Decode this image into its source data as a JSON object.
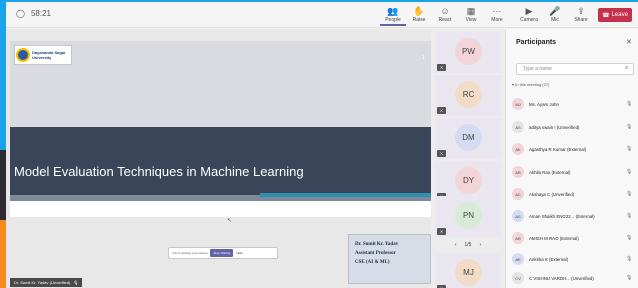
{
  "top_bar": {
    "timer": "58:21",
    "buttons": [
      {
        "label": "People",
        "icon": "people-icon"
      },
      {
        "label": "Raise",
        "icon": "raise-hand-icon"
      },
      {
        "label": "React",
        "icon": "react-icon"
      },
      {
        "label": "View",
        "icon": "view-icon"
      },
      {
        "label": "More",
        "icon": "more-icon"
      },
      {
        "label": "Camera",
        "icon": "camera-icon"
      },
      {
        "label": "Mic",
        "icon": "mic-icon"
      },
      {
        "label": "Share",
        "icon": "share-icon"
      }
    ],
    "leave_label": "Leave"
  },
  "slide": {
    "logo_text_line1": "Dayananda Sagar",
    "logo_text_line2": "University",
    "title": "Model Evaluation Techniques in Machine Learning",
    "page_number": "1"
  },
  "share_notice": {
    "text": "You're sharing your screen",
    "stop_label": "Stop sharing",
    "hide_label": "Hide"
  },
  "presenter_card": {
    "name": "Dr. Sumit Kr. Yadav",
    "role": "Assistant Professor",
    "dept": "CSE (AI & ML)"
  },
  "presenter_label": "Dr. Sumit Kr. Yadav (Unverified)",
  "gallery": {
    "tiles": [
      {
        "initials": "PW",
        "color": "#f3d4d8"
      },
      {
        "initials": "RC",
        "color": "#f2dcc8"
      },
      {
        "initials": "DM",
        "color": "#d5dcf2"
      },
      {
        "initials": "DY",
        "color": "#f3d4d8"
      },
      {
        "initials": "PN",
        "color": "#d6ecd6"
      },
      {
        "initials": "MJ",
        "color": "#f2dcc8"
      }
    ],
    "pager": "1/5"
  },
  "participants": {
    "title": "Participants",
    "search_placeholder": "Type a name",
    "section_label": "In this meeting (37)",
    "rows": [
      {
        "initials": "MJ",
        "name": "Ms. Ayam John",
        "color": "#f3d4d8"
      },
      {
        "initials": "AS",
        "name": "aditya swain ! (Unverified)",
        "color": "#e4e4e4"
      },
      {
        "initials": "AK",
        "name": "Agasthya R Kumar (External)",
        "color": "#f3d4d8"
      },
      {
        "initials": "AR",
        "name": "Akhila Rao (External)",
        "color": "#f3d4d8"
      },
      {
        "initials": "AC",
        "name": "Akshaya C (Unverified)",
        "color": "#f3d4d8"
      },
      {
        "initials": "AS",
        "name": "Aman Shaikh ENG22... (External)",
        "color": "#d5dcf2"
      },
      {
        "initials": "AR",
        "name": "AMISH M RAO (External)",
        "color": "#f3d4d8"
      },
      {
        "initials": "AK",
        "name": "Ankitha K (External)",
        "color": "#d5dcf2"
      },
      {
        "initials": "CV",
        "name": "C VISHNU VARDH... (Unverified)",
        "color": "#e4e4e4"
      }
    ]
  }
}
